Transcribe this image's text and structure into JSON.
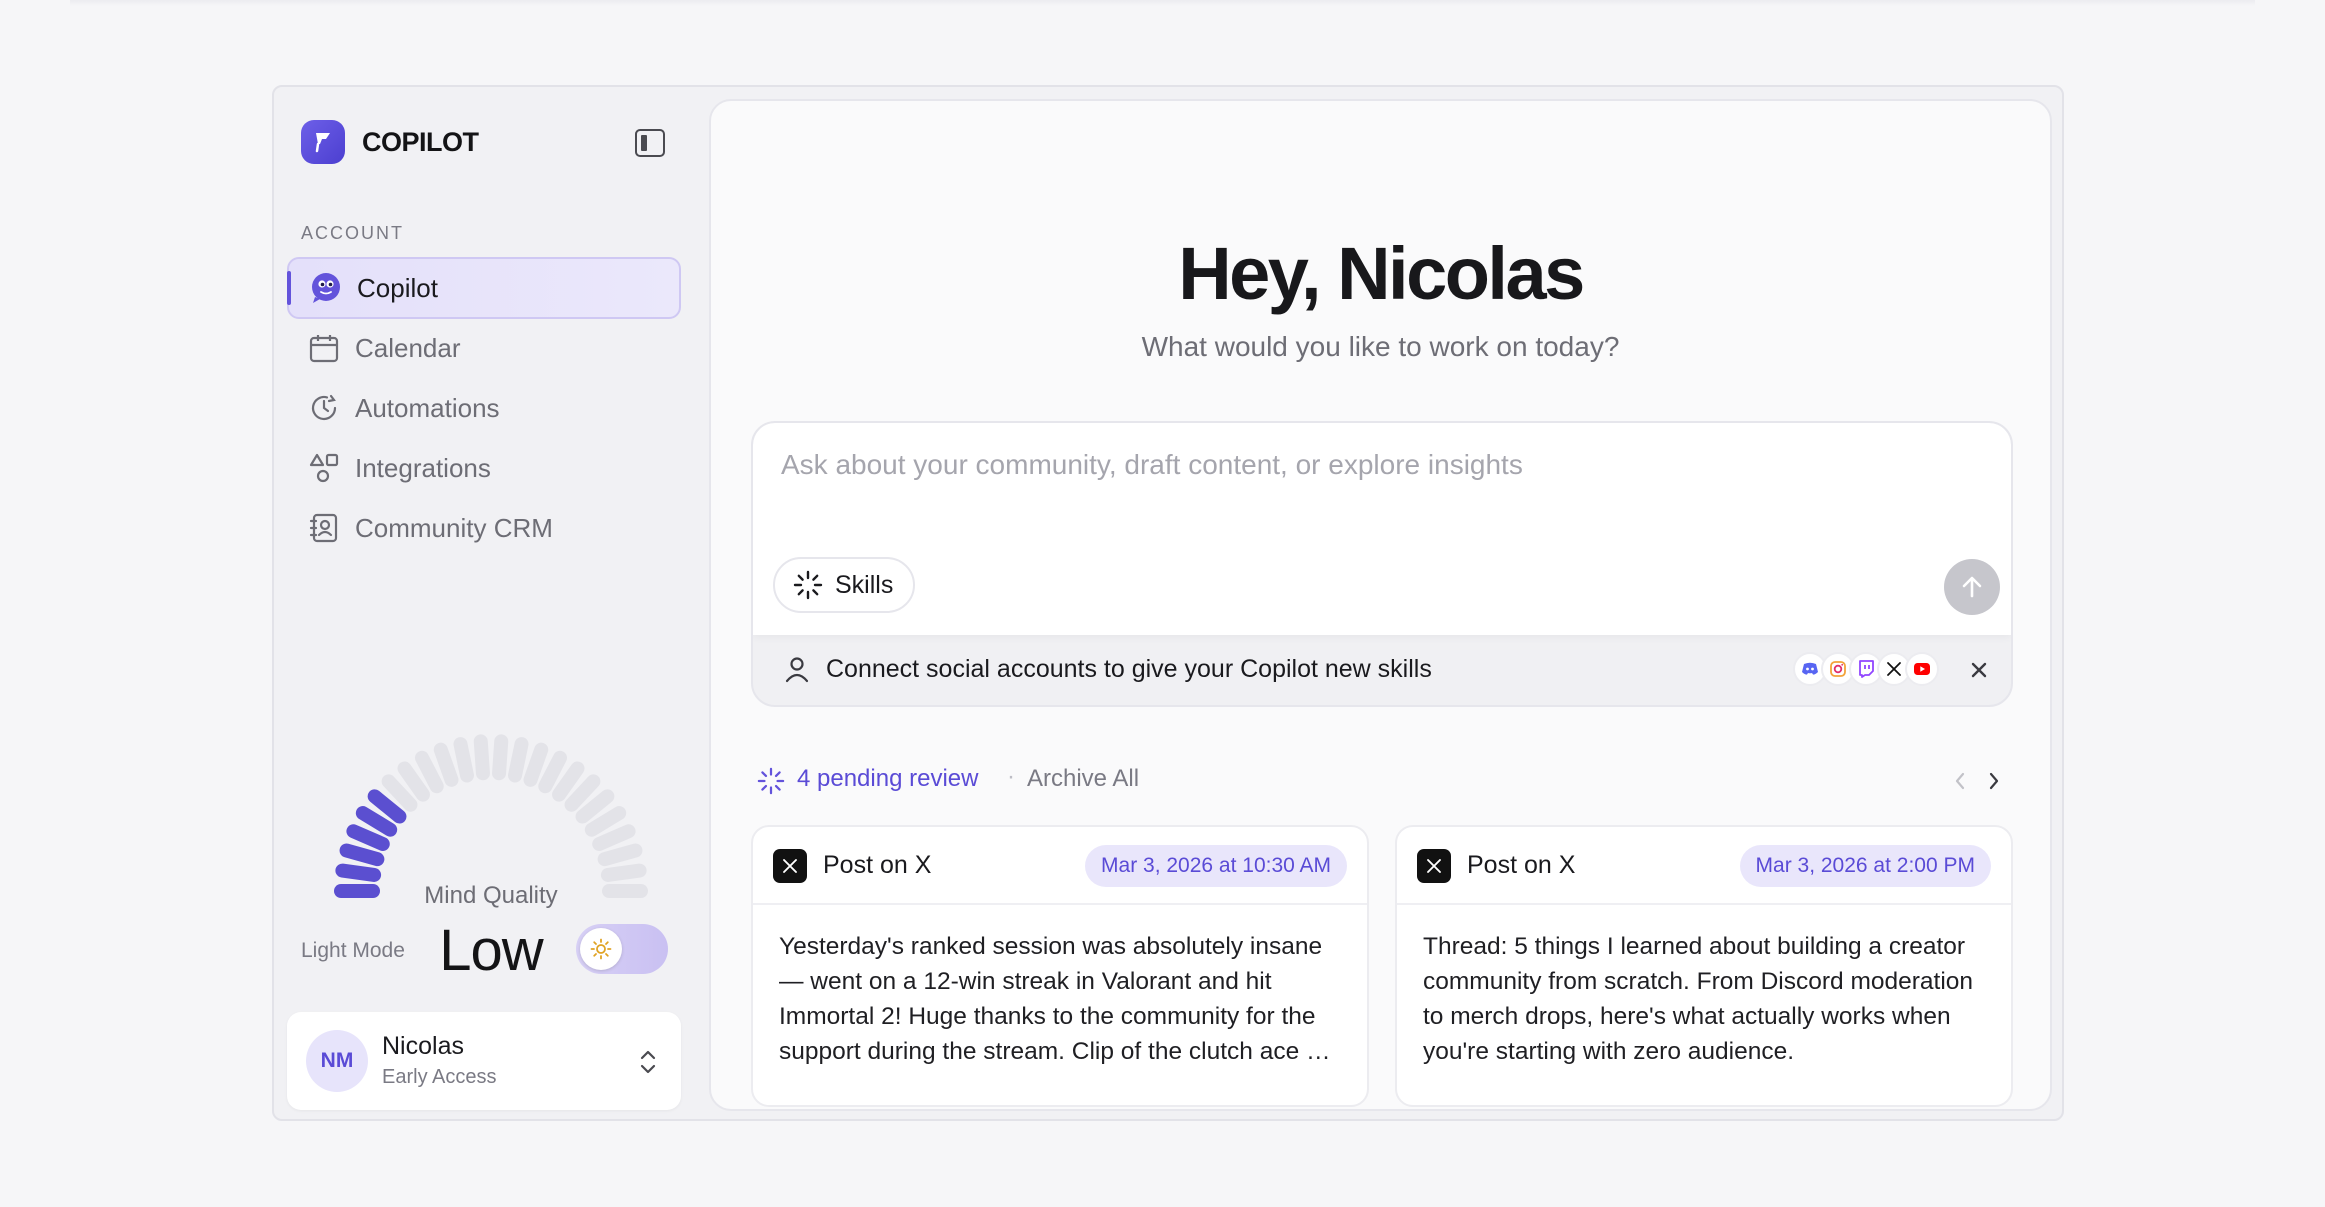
{
  "brand": {
    "name": "COPILOT",
    "logo_icon": "copilot-flag-logo"
  },
  "sidebar": {
    "section_label": "ACCOUNT",
    "items": [
      {
        "label": "Copilot",
        "icon": "copilot-face-icon",
        "active": true
      },
      {
        "label": "Calendar",
        "icon": "calendar-icon",
        "active": false
      },
      {
        "label": "Automations",
        "icon": "automation-clock-icon",
        "active": false
      },
      {
        "label": "Integrations",
        "icon": "shapes-icon",
        "active": false
      },
      {
        "label": "Community CRM",
        "icon": "contact-book-icon",
        "active": false
      }
    ],
    "mind_quality": {
      "title": "Mind Quality",
      "value": "Low",
      "segments_total": 24,
      "segments_filled": 6
    },
    "light_mode": {
      "label": "Light Mode",
      "enabled": true
    },
    "user": {
      "initials": "NM",
      "name": "Nicolas",
      "plan": "Early Access"
    }
  },
  "main": {
    "greeting": "Hey, Nicolas",
    "subtitle": "What would you like to work on today?",
    "composer": {
      "placeholder": "Ask about your community, draft content, or explore insights",
      "value": "",
      "skills_label": "Skills"
    },
    "connect_banner": {
      "text": "Connect social accounts to give your Copilot new skills",
      "socials": [
        "discord",
        "instagram",
        "twitch",
        "x",
        "youtube"
      ]
    },
    "review": {
      "pending_label": "4 pending review",
      "archive_label": "Archive All",
      "separator": "·"
    },
    "cards": [
      {
        "type": "Post on X",
        "date": "Mar 3, 2026 at 10:30 AM",
        "body": "Yesterday's ranked session was absolutely insane — went on a 12-win streak in Valorant and hit Immortal 2! Huge thanks to the community for the support during the stream. Clip of the clutch ace on Ascent coming soon!"
      },
      {
        "type": "Post on X",
        "date": "Mar 3, 2026 at 2:00 PM",
        "body": "Thread: 5 things I learned about building a creator community from scratch. From Discord moderation to merch drops, here's what actually works when you're starting with zero audience."
      }
    ]
  },
  "colors": {
    "accent": "#5a4bd6",
    "accent_soft": "#e9e6fb",
    "gauge_filled": "#5b4fd0",
    "gauge_empty": "#e3e3e8",
    "background": "#f6f6f8"
  }
}
